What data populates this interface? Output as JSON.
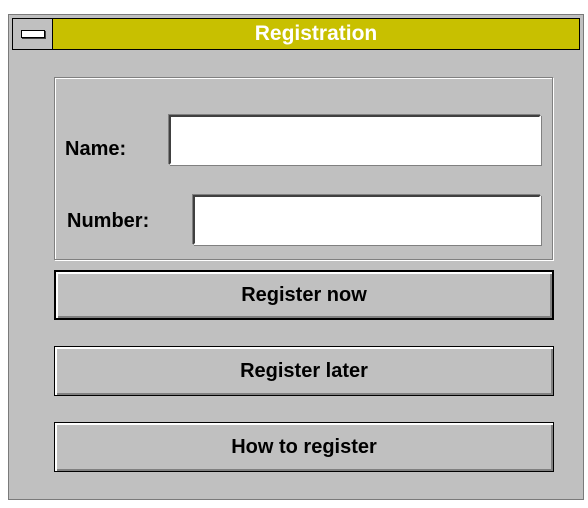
{
  "window": {
    "title": "Registration",
    "title_bar_color": "#c8c000",
    "face_color": "#c0c0c0"
  },
  "form": {
    "name_label": "Name:",
    "name_value": "",
    "number_label": "Number:",
    "number_value": ""
  },
  "buttons": {
    "register_now": "Register now",
    "register_later": "Register later",
    "how_to_register": "How to register"
  }
}
